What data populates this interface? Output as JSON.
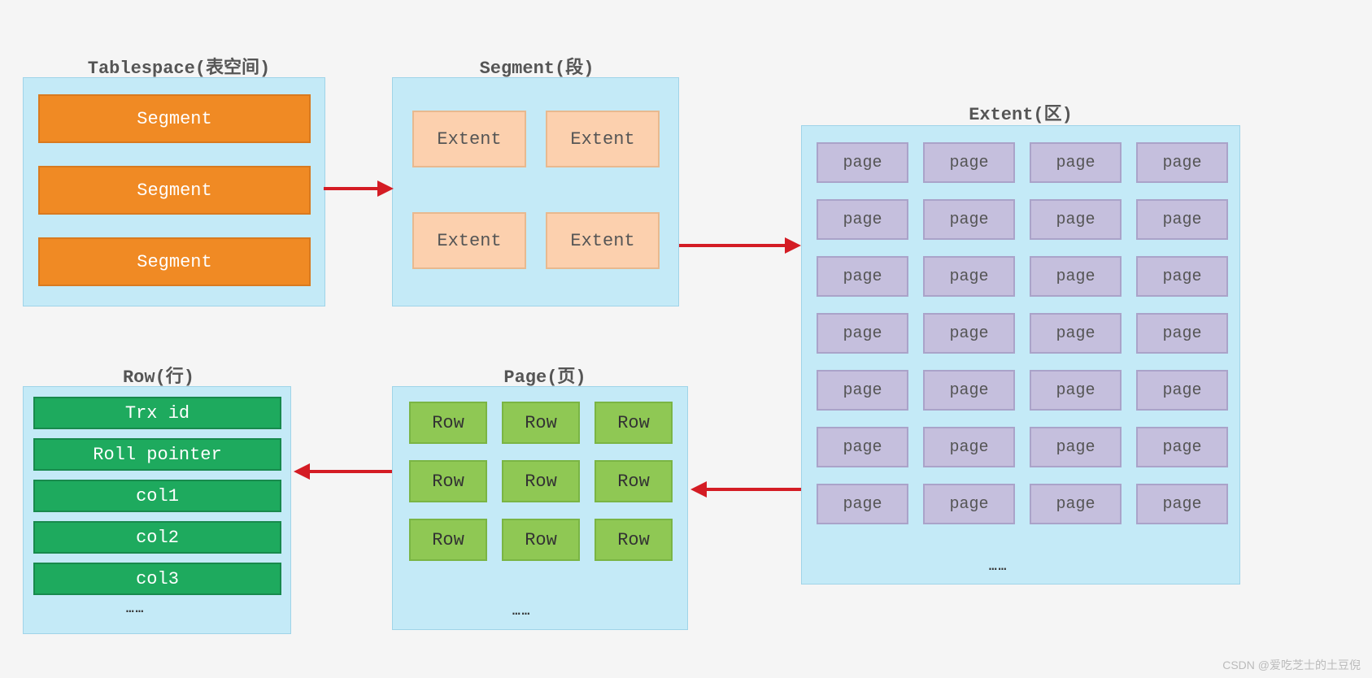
{
  "tablespace": {
    "title": "Tablespace(表空间)",
    "items": [
      "Segment",
      "Segment",
      "Segment"
    ]
  },
  "segment": {
    "title": "Segment(段)",
    "items": [
      "Extent",
      "Extent",
      "Extent",
      "Extent"
    ]
  },
  "extent": {
    "title": "Extent(区)",
    "cell": "page",
    "ellipsis": "……"
  },
  "page": {
    "title": "Page(页)",
    "cell": "Row",
    "ellipsis": "……"
  },
  "row": {
    "title": "Row(行)",
    "items": [
      "Trx id",
      "Roll pointer",
      "col1",
      "col2",
      "col3"
    ],
    "ellipsis": "……"
  },
  "watermark": "CSDN @爱吃芝士的土豆倪"
}
